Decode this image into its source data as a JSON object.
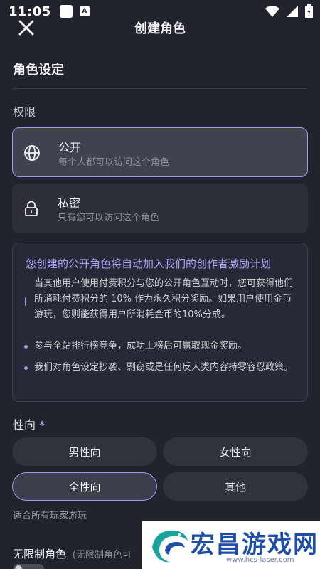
{
  "status_bar": {
    "time": "11:05",
    "notif_a": "A"
  },
  "app_bar": {
    "title": "创建角色"
  },
  "section": {
    "title": "角色设定"
  },
  "permission": {
    "label": "权限",
    "options": [
      {
        "title": "公开",
        "desc": "每个人都可以访问这个角色",
        "icon": "globe-icon",
        "selected": true
      },
      {
        "title": "私密",
        "desc": "只有您可以访问这个角色",
        "icon": "lock-icon",
        "selected": false
      }
    ]
  },
  "incentive": {
    "heading": "您创建的公开角色将自动加入我们的创作者激励计划",
    "items": [
      "当其他用户使用付费积分与您的公开角色互动时，您可获得他们所消耗付费积分的 10% 作为永久积分奖励。如果用户使用金币游玩，您则能获得用户所消耗金币的10%分成。",
      "参与全站排行榜竞争，成功上榜后可赢取现金奖励。",
      "我们对角色设定抄袭、剽窃或是任何反人类内容持零容忍政策。"
    ]
  },
  "orientation": {
    "label": "性向",
    "required_mark": "*",
    "options": [
      "男性向",
      "女性向",
      "全性向",
      "其他"
    ],
    "selected": "全性向",
    "hint": "适合所有玩家游玩"
  },
  "unrestricted": {
    "label": "无限制角色",
    "sub": "(无限制角色可",
    "enabled": false
  },
  "watermark": {
    "title": "宏昌游戏网",
    "url": "www.hcs-laser.com"
  },
  "colors": {
    "background": "#22232c",
    "accent": "#9e9cf0",
    "card": "#2d2e38"
  }
}
